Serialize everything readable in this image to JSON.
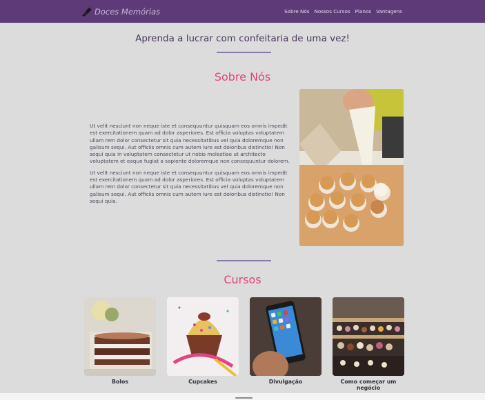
{
  "brand": {
    "name": "Doces Memórias",
    "icon": "piping-bag-icon"
  },
  "nav": {
    "links": [
      "Sobre Nós",
      "Nossos Cursos",
      "Planos",
      "Vantagens"
    ]
  },
  "headline": "Aprenda a lucrar com confeitaria de uma vez!",
  "about": {
    "title": "Sobre Nós",
    "paragraphs": [
      "Ut velit nesciunt non neque iste et consequuntur quisquam eos omnis impedit est exercitationem quam ad dolor asperiores. Est officia voluptas voluptatem ullam rem dolor consectetur sit quia necessitatibus vel quia doloremque non galisum sequi. Aut officiis omnis cum autem iure est doloribus distinctio! Non sequi quia in voluptatem consectetur ut nobis molestiae ut architecto voluptatem et eaque fugiat a sapiente doloremque non consequuntur dolorem.",
      "Ut velit nesciunt non neque iste et consequuntur quisquam eos omnis impedit est exercitationem quam ad dolor asperiores. Est officia voluptas voluptatem ullam rem dolor consectetur sit quia necessitatibus vel quia doloremque non galisum sequi. Aut officiis omnis cum autem iure est doloribus distinctio! Non sequi quia."
    ]
  },
  "courses": {
    "title": "Cursos",
    "items": [
      {
        "label": "Bolos"
      },
      {
        "label": "Cupcakes"
      },
      {
        "label": "Divulgação"
      },
      {
        "label": "Como começar um negócio"
      }
    ]
  },
  "colors": {
    "navbar": "#5e3a78",
    "accent": "#e0457f",
    "background": "#dcdcdc"
  }
}
